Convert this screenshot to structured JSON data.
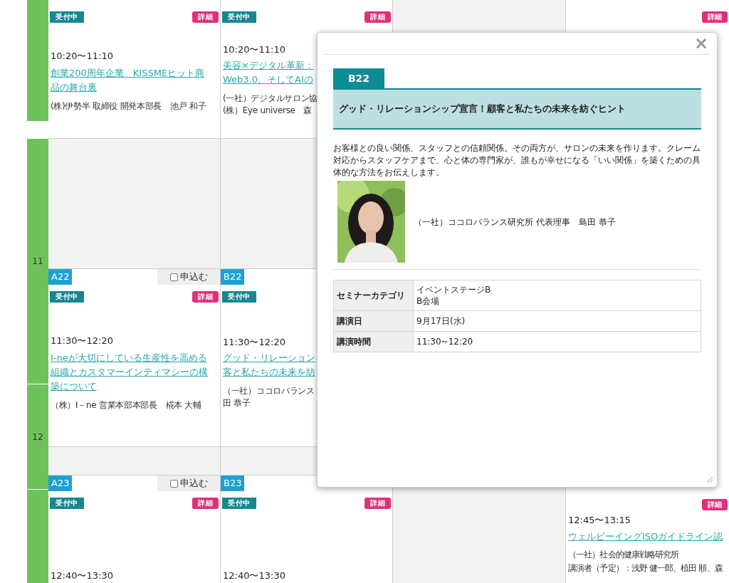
{
  "hours": [
    {
      "label": "11"
    },
    {
      "label": "12"
    }
  ],
  "column_a": [
    {
      "status": "受付中",
      "detail_label": "詳細",
      "time": "10:20〜11:10",
      "title": "創業200周年企業　KISSMEヒット商品の舞台裏",
      "speaker": [
        "(株)伊勢半 取締役 開発本部長　池戸 和子"
      ]
    },
    {
      "code": "A22",
      "apply_label": "申込む",
      "apply_checked": false,
      "status": "受付中",
      "detail_label": "詳細",
      "time": "11:30〜12:20",
      "title": "I-neが大切にしている生産性を高める組織とカスタマーインティマシーの構築について",
      "speaker": [
        "（株）I－ne 営業本部本部長　椛本 大輔"
      ]
    },
    {
      "code": "A23",
      "apply_label": "申込む",
      "apply_checked": false,
      "status": "受付中",
      "detail_label": "詳細",
      "time": "12:40〜13:30"
    }
  ],
  "column_b": [
    {
      "status": "受付中",
      "detail_label": "詳細",
      "time": "10:20〜11:10",
      "title_lines": [
        "美容×デジタル革新：",
        "Web3.0、そしてAIの"
      ],
      "speaker": [
        "(一社）デジタルサロン協",
        "(株）Eye universe　森"
      ]
    },
    {
      "code": "B22",
      "status": "受付中",
      "time": "11:30〜12:20",
      "title_lines": [
        "グッド・リレーション",
        "客と私たちの未来を紡"
      ],
      "speaker": [
        "（一社）ココロバランス",
        "田 恭子"
      ]
    },
    {
      "code": "B23",
      "status": "受付中",
      "detail_label": "詳細",
      "time": "12:40〜13:30"
    }
  ],
  "column_d": {
    "top": {
      "detail_label": "詳細"
    },
    "bottom": {
      "detail_label": "詳細",
      "time": "12:45〜13:15",
      "title": "ウェルビーイングISOガイドライン認",
      "speaker": [
        "（一社）社会的健康戦略研究所",
        "講演者（予定）：浅野 健一郎、植田 順、森"
      ]
    }
  },
  "modal": {
    "close": "×",
    "tab": "B22",
    "title": "グッド・リレーションシップ宣言！顧客と私たちの未来を紡ぐヒント",
    "description": "お客様との良い関係、スタッフとの信頼関係。その両方が、サロンの未来を作ります。クレーム対応からスタッフケアまで、心と体の専門家が、誰もが幸せになる「いい関係」を築くための具体的な方法をお伝えします。",
    "speaker": "（一社）ココロバランス研究所 代表理事　島田 恭子",
    "table": [
      {
        "label": "セミナーカテゴリ",
        "value": [
          "イベントステージB",
          "B会場"
        ]
      },
      {
        "label": "講演日",
        "value": [
          "9月17日(水)"
        ]
      },
      {
        "label": "講演時間",
        "value": [
          "11:30~12:20"
        ]
      }
    ]
  }
}
